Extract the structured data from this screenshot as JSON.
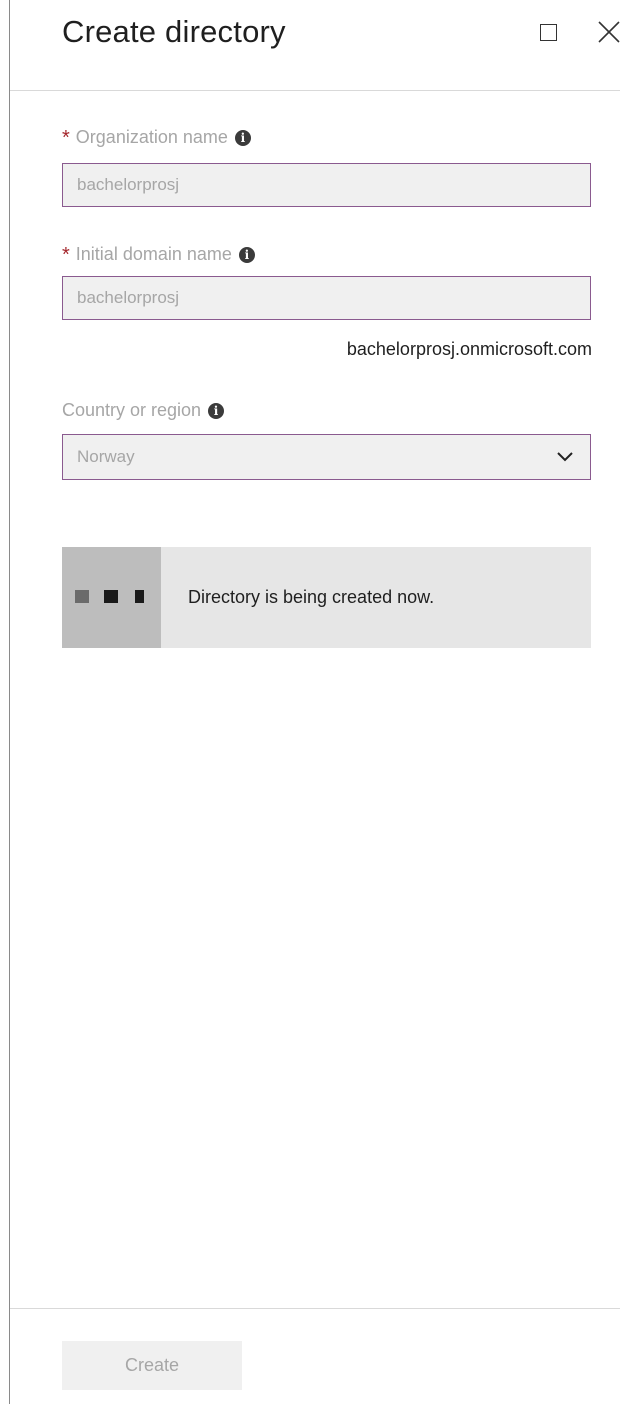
{
  "header": {
    "title": "Create directory"
  },
  "form": {
    "organization_name": {
      "required_mark": "*",
      "label": "Organization name",
      "value": "bachelorprosj",
      "info_icon": "info-icon"
    },
    "initial_domain_name": {
      "required_mark": "*",
      "label": "Initial domain name",
      "value": "bachelorprosj",
      "suffix": "bachelorprosj.onmicrosoft.com",
      "info_icon": "info-icon"
    },
    "country_or_region": {
      "label": "Country or region",
      "selected": "Norway",
      "info_icon": "info-icon"
    }
  },
  "status": {
    "message": "Directory is being created now.",
    "icon": "loading-dots-icon"
  },
  "footer": {
    "create_label": "Create"
  },
  "colors": {
    "required": "#a4262c",
    "input_border": "#8a5a8f",
    "input_bg": "#f0f0f0",
    "disabled_text": "#a6a6a6"
  }
}
